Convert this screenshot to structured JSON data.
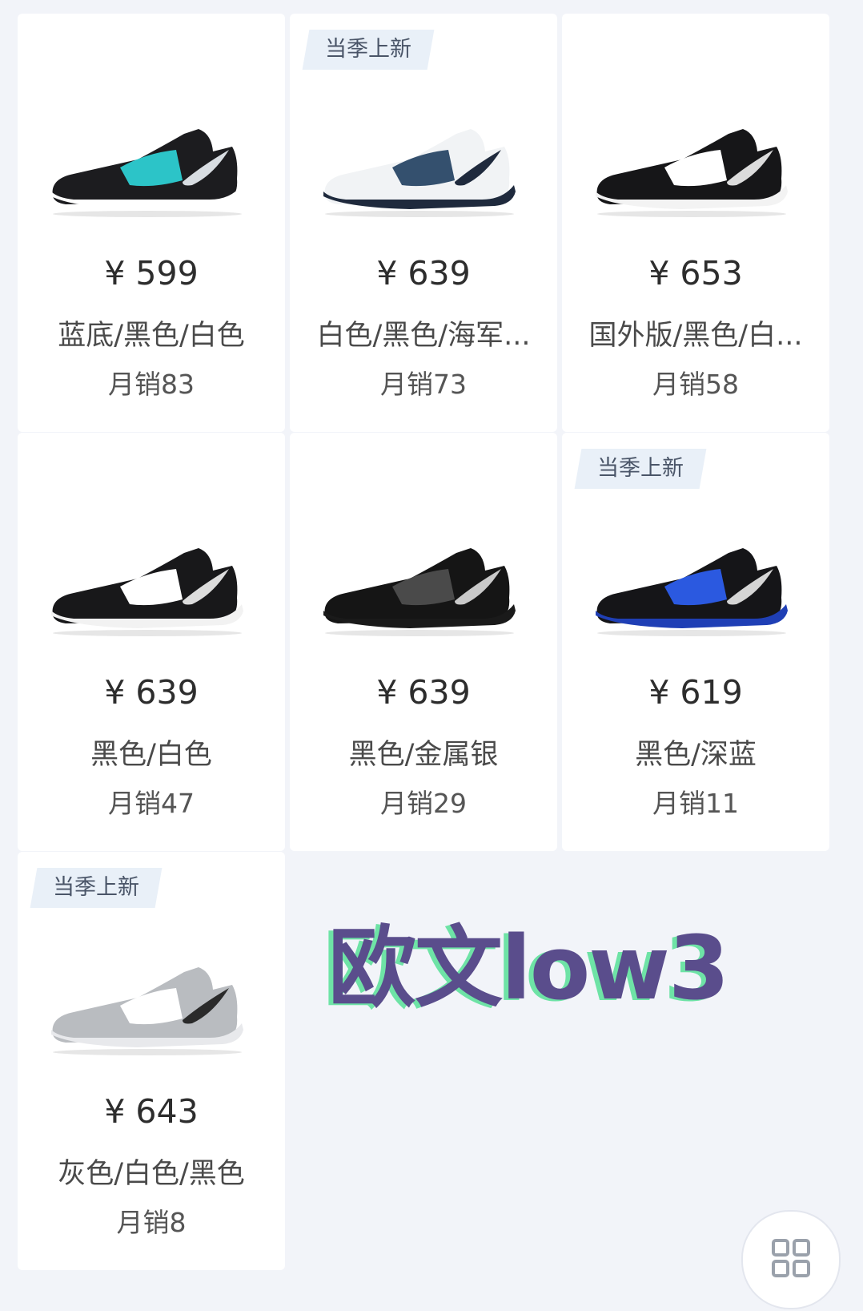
{
  "products": [
    {
      "price": "¥ 599",
      "name": "蓝底/黑色/白色",
      "sales": "月销83",
      "tag": "",
      "colors": {
        "upper": "#1c1c1f",
        "sole": "#ffffff",
        "accent": "#2cc4c8",
        "logo": "#d8dde2"
      }
    },
    {
      "price": "¥ 639",
      "name": "白色/黑色/海军...",
      "sales": "月销73",
      "tag": "当季上新",
      "colors": {
        "upper": "#f1f3f5",
        "sole": "#1f2a3d",
        "accent": "#34506e",
        "logo": "#1f2a3d"
      }
    },
    {
      "price": "¥ 653",
      "name": "国外版/黑色/白...",
      "sales": "月销58",
      "tag": "",
      "colors": {
        "upper": "#161618",
        "sole": "#f3f3f3",
        "accent": "#ffffff",
        "logo": "#dcdcdc"
      }
    },
    {
      "price": "¥ 639",
      "name": "黑色/白色",
      "sales": "月销47",
      "tag": "",
      "colors": {
        "upper": "#18181a",
        "sole": "#f2f2f2",
        "accent": "#ffffff",
        "logo": "#dcdcdc"
      }
    },
    {
      "price": "¥ 639",
      "name": "黑色/金属银",
      "sales": "月销29",
      "tag": "",
      "colors": {
        "upper": "#151515",
        "sole": "#1a1a1a",
        "accent": "#4a4a4a",
        "logo": "#c9c9c9"
      }
    },
    {
      "price": "¥ 619",
      "name": "黑色/深蓝",
      "sales": "月销11",
      "tag": "当季上新",
      "colors": {
        "upper": "#151518",
        "sole": "#1f3fb5",
        "accent": "#2b59e0",
        "logo": "#d5d5d5"
      }
    },
    {
      "price": "¥ 643",
      "name": "灰色/白色/黑色",
      "sales": "月销8",
      "tag": "当季上新",
      "colors": {
        "upper": "#b9bcc0",
        "sole": "#e8e9ec",
        "accent": "#ffffff",
        "logo": "#2a2a2a"
      }
    }
  ],
  "watermark": "欧文low3",
  "grid_button_icon": "grid-icon"
}
